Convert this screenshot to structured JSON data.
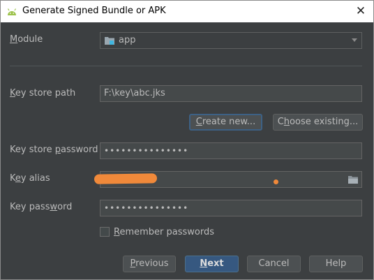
{
  "window": {
    "title": "Generate Signed Bundle or APK",
    "close_glyph": "✕",
    "icon": "android-icon"
  },
  "module": {
    "label": "Module",
    "label_mnemonic": "M",
    "label_rest": "odule",
    "value": "app",
    "icon": "module-folder-icon"
  },
  "key_store_path": {
    "label_mnemonic": "K",
    "label_rest": "ey store path",
    "value": "F:\\key\\abc.jks"
  },
  "buttons_keystore": {
    "create_mnemonic": "C",
    "create_rest": "reate new...",
    "choose_pre": "C",
    "choose_mnemonic": "h",
    "choose_rest": "oose existing..."
  },
  "key_store_password": {
    "label_pre": "Key store ",
    "label_mnemonic": "p",
    "label_rest": "assword",
    "value": "•••••••••••••••"
  },
  "key_alias": {
    "label_pre": "K",
    "label_mnemonic": "e",
    "label_rest": "y alias",
    "value": "",
    "browse_icon": "folder-icon"
  },
  "key_password": {
    "label_pre": "Key pass",
    "label_mnemonic": "w",
    "label_rest": "ord",
    "value": "•••••••••••••••"
  },
  "remember": {
    "label_mnemonic": "R",
    "label_rest": "emember passwords",
    "checked": false
  },
  "footer": {
    "previous_mnemonic": "P",
    "previous_rest": "revious",
    "next_mnemonic": "N",
    "next_rest": "ext",
    "cancel": "Cancel",
    "help": "Help"
  },
  "colors": {
    "background": "#3c3f41",
    "primary_button": "#365880",
    "redaction": "#f0893a"
  }
}
